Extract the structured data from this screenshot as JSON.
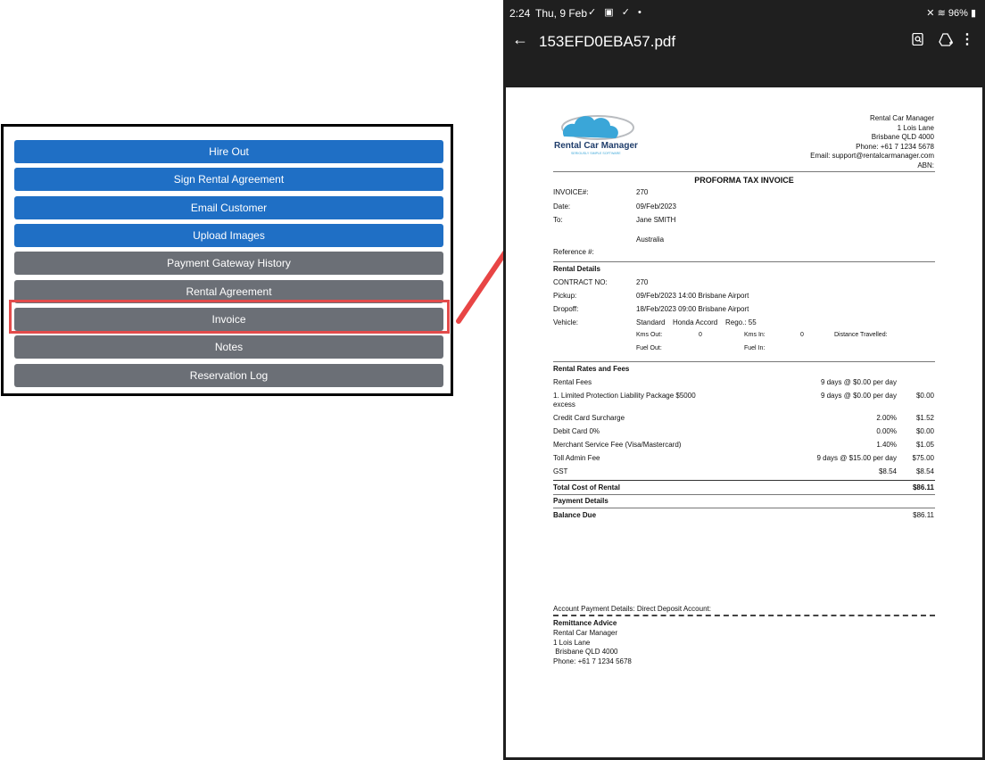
{
  "menu": {
    "buttons": [
      {
        "label": "Hire Out",
        "style": "blue"
      },
      {
        "label": "Sign Rental Agreement",
        "style": "blue"
      },
      {
        "label": "Email Customer",
        "style": "blue"
      },
      {
        "label": "Upload Images",
        "style": "blue"
      },
      {
        "label": "Payment Gateway History",
        "style": "grey"
      },
      {
        "label": "Rental Agreement",
        "style": "grey"
      },
      {
        "label": "Invoice",
        "style": "grey"
      },
      {
        "label": "Notes",
        "style": "grey"
      },
      {
        "label": "Reservation Log",
        "style": "grey"
      }
    ],
    "highlighted": "Invoice",
    "colors": {
      "blue": "#1f6fc5",
      "grey": "#6b6f76",
      "highlight": "#e24b4b"
    }
  },
  "status_bar": {
    "time": "2:24",
    "date": "Thu, 9 Feb",
    "icons_left": "✓ ▣ ✓ •",
    "battery": "96%"
  },
  "app_bar": {
    "title": "153EFD0EBA57.pdf",
    "back_icon": "arrow-left-icon",
    "actions": [
      "search-doc-icon",
      "drive-add-icon",
      "more-vert-icon"
    ]
  },
  "invoice": {
    "logo_text": "Rental Car Manager",
    "logo_tagline": "SERIOUSLY SIMPLE SOFTWARE",
    "company": {
      "name": "Rental Car Manager",
      "address1": "1 Lois Lane",
      "address2": "Brisbane QLD 4000",
      "phone": "Phone: +61 7 1234 5678",
      "email": "Email: support@rentalcarmanager.com",
      "abn": "ABN:"
    },
    "title": "PROFORMA TAX INVOICE",
    "header_fields": [
      {
        "label": "INVOICE#:",
        "value": "270"
      },
      {
        "label": "Date:",
        "value": "09/Feb/2023"
      },
      {
        "label": "To:",
        "value": "Jane SMITH"
      }
    ],
    "to_country": "Australia",
    "reference_label": "Reference #:",
    "rental_details": {
      "heading": "Rental Details",
      "contract_label": "CONTRACT NO:",
      "contract_value": "270",
      "pickup_label": "Pickup:",
      "pickup_value": "09/Feb/2023 14:00 Brisbane Airport",
      "dropoff_label": "Dropoff:",
      "dropoff_value": "18/Feb/2023 09:00 Brisbane Airport",
      "vehicle_label": "Vehicle:",
      "vehicle_class": "Standard",
      "vehicle_model": "Honda Accord",
      "vehicle_rego": "Rego.: 55",
      "kms_out_label": "Kms Out:",
      "kms_out_value": "0",
      "kms_in_label": "Kms In:",
      "kms_in_value": "0",
      "distance_label": "Distance Travelled:",
      "fuel_out_label": "Fuel Out:",
      "fuel_in_label": "Fuel In:"
    },
    "rates": {
      "heading": "Rental Rates and Fees",
      "rows": [
        {
          "name": "Rental Fees",
          "rate": "9 days @ $0.00 per day",
          "amount": ""
        },
        {
          "name": "1. Limited Protection Liability Package $5000",
          "name2": "excess",
          "rate": "9 days @ $0.00 per day",
          "amount": "$0.00"
        },
        {
          "name": "Credit Card Surcharge",
          "rate": "2.00%",
          "amount": "$1.52"
        },
        {
          "name": "Debit Card 0%",
          "rate": "0.00%",
          "amount": "$0.00"
        },
        {
          "name": "Merchant Service Fee (Visa/Mastercard)",
          "rate": "1.40%",
          "amount": "$1.05"
        },
        {
          "name": "Toll Admin Fee",
          "rate": "9 days @ $15.00 per day",
          "amount": "$75.00"
        },
        {
          "name": "GST",
          "rate": "$8.54",
          "amount": "$8.54"
        }
      ]
    },
    "total_label": "Total Cost of Rental",
    "total_value": "$86.11",
    "payment_heading": "Payment Details",
    "balance_label": "Balance Due",
    "balance_value": "$86.11",
    "account_payment": "Account Payment Details: Direct Deposit Account:",
    "remittance": {
      "heading": "Remittance Advice",
      "line1": "Rental Car Manager",
      "line2": "1 Lois Lane",
      "line3": " Brisbane QLD 4000",
      "line4": "Phone: +61 7 1234 5678"
    }
  }
}
